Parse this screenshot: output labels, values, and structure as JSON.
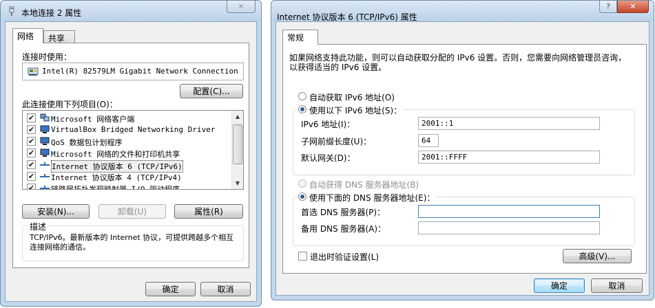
{
  "left_dialog": {
    "title": "本地连接 2 属性",
    "tabs": [
      {
        "label": "网络",
        "active": true
      },
      {
        "label": "共享",
        "active": false
      }
    ],
    "connect_using_label": "连接时使用：",
    "adapter_name": "Intel(R) 82579LM Gigabit Network Connection",
    "configure_button": "配置(C)...",
    "items_label": "此连接使用下列项目(O)：",
    "items": [
      {
        "label": "Microsoft 网络客户端",
        "checked": true,
        "icon": "network-client-icon"
      },
      {
        "label": "VirtualBox Bridged Networking Driver",
        "checked": true,
        "icon": "network-service-icon"
      },
      {
        "label": "QoS 数据包计划程序",
        "checked": true,
        "icon": "network-service-icon"
      },
      {
        "label": "Microsoft 网络的文件和打印机共享",
        "checked": true,
        "icon": "network-service-icon"
      },
      {
        "label": "Internet 协议版本 6 (TCP/IPv6)",
        "checked": true,
        "icon": "protocol-icon",
        "selected": true
      },
      {
        "label": "Internet 协议版本 4 (TCP/IPv4)",
        "checked": true,
        "icon": "protocol-icon"
      },
      {
        "label": "链路层拓扑发现映射器 I/O 驱动程序",
        "checked": true,
        "icon": "protocol-icon"
      }
    ],
    "install_button": "安装(N)...",
    "uninstall_button": "卸载(U)",
    "properties_button": "属性(R)",
    "description_label": "描述",
    "description_text": "TCP/IPv6。最新版本的 Internet 协议，可提供跨越多个相互连接网络的通信。",
    "ok_button": "确定",
    "cancel_button": "取消"
  },
  "right_dialog": {
    "title": "Internet 协议版本 6 (TCP/IPv6) 属性",
    "help_glyph": "?",
    "close_glyph": "✕",
    "tab": "常规",
    "intro_text": "如果网络支持此功能，则可以自动获取分配的 IPv6 设置。否则，您需要向网络管理员咨询，以获得适当的 IPv6 设置。",
    "auto_ip_label": "自动获取 IPv6 地址(O)",
    "manual_ip_label": "使用以下 IPv6 地址(S)：",
    "ipv6_address_label": "IPv6 地址(I)：",
    "ipv6_address_value": "2001::1",
    "prefix_length_label": "子网前缀长度(U)：",
    "prefix_length_value": "64",
    "gateway_label": "默认网关(D)：",
    "gateway_value": "2001::FFFF",
    "auto_dns_label": "自动获得 DNS 服务器地址(B)",
    "manual_dns_label": "使用下面的 DNS 服务器地址(E)：",
    "preferred_dns_label": "首选 DNS 服务器(P)：",
    "preferred_dns_value": "",
    "alternate_dns_label": "备用 DNS 服务器(A)：",
    "alternate_dns_value": "",
    "validate_label": "退出时验证设置(L)",
    "validate_checked": false,
    "advanced_button": "高级(V)...",
    "ok_button": "确定",
    "cancel_button": "取消"
  },
  "colors": {
    "window_frame": "#c3d7ec",
    "dialog_face": "#f0f0f0",
    "accent": "#3c7fb1",
    "close_red": "#c6452a"
  }
}
